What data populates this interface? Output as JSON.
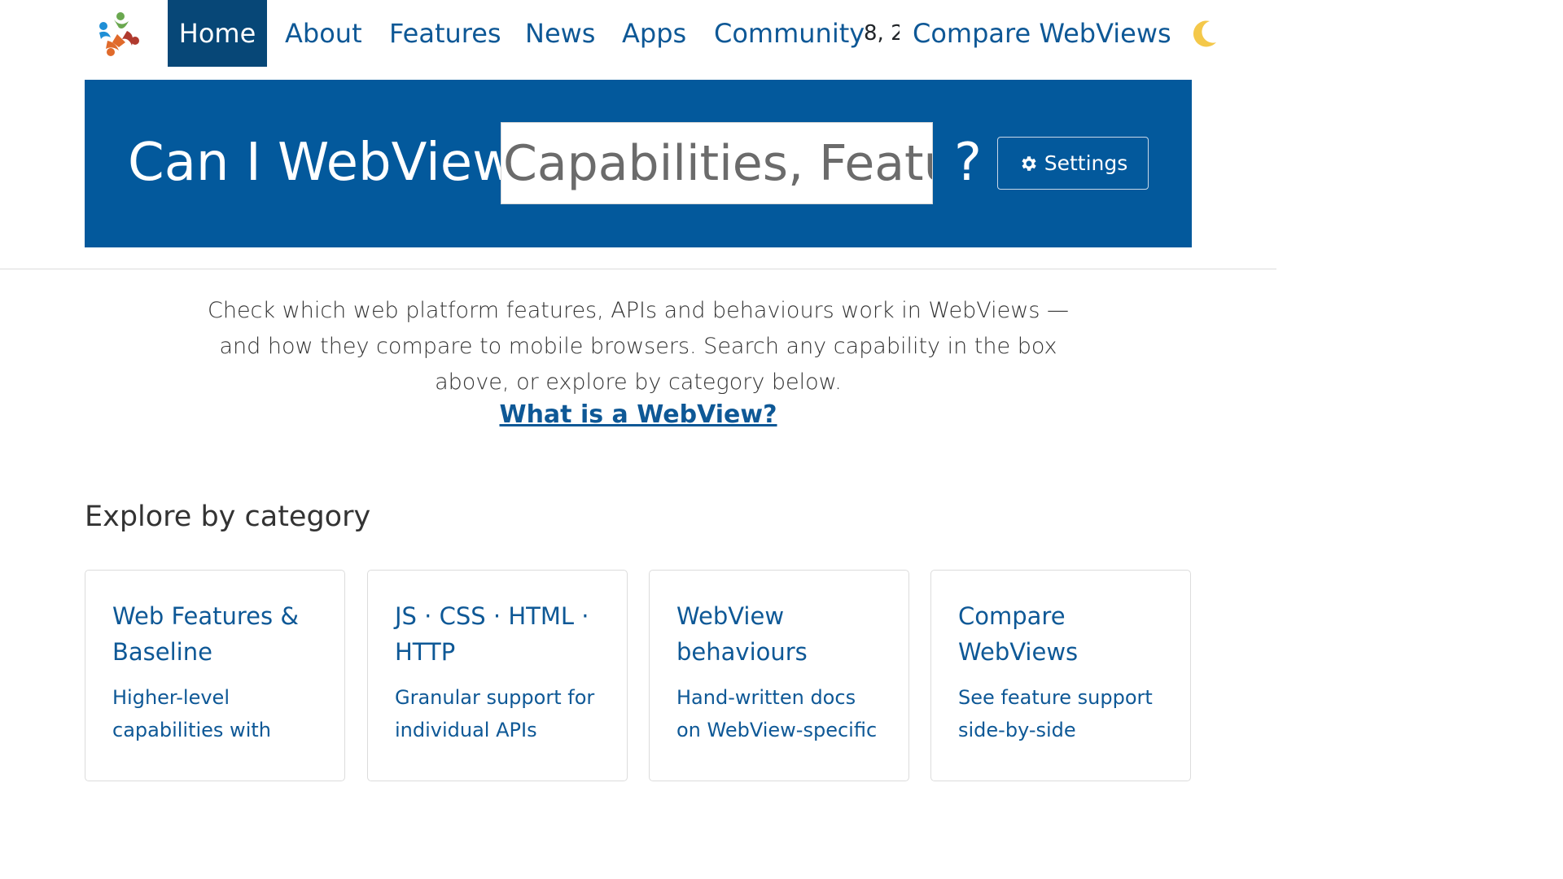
{
  "nav": {
    "home": "Home",
    "about": "About",
    "features": "Features",
    "news": "News",
    "apps": "Apps",
    "community": "Community",
    "community_count": "8, 2",
    "compare": "Compare WebViews",
    "theme_icon": "moon-icon"
  },
  "hero": {
    "title": "Can I WebView",
    "search_placeholder": "Capabilities, Features",
    "question_mark": "?",
    "settings_label": "Settings",
    "settings_icon": "gear-icon"
  },
  "intro": {
    "text": "Check which web platform features, APIs and behaviours work in WebViews — and how they compare to mobile browsers. Search any capability in the box above, or explore by category below.",
    "link_label": "What is a WebView?"
  },
  "categories": {
    "heading": "Explore by category",
    "items": [
      {
        "title": "Web Features & Baseline",
        "description": "Higher-level capabilities with"
      },
      {
        "title": "JS · CSS · HTML · HTTP",
        "description": "Granular support for individual APIs"
      },
      {
        "title": "WebView behaviours",
        "description": "Hand-written docs on WebView-specific"
      },
      {
        "title": "Compare WebViews",
        "description": "See feature support side-by-side"
      }
    ]
  },
  "colors": {
    "brand_blue": "#03599c",
    "nav_active": "#074777",
    "link_blue": "#0e5896"
  }
}
